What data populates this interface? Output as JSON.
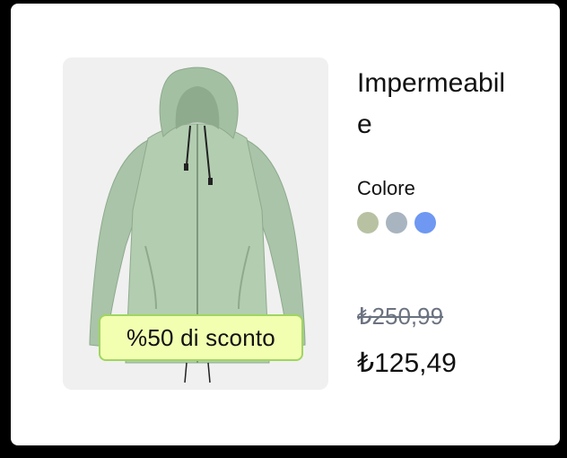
{
  "product": {
    "title": "Impermeabile",
    "image_icon": "green-rain-jacket",
    "discount_badge": "%50 di sconto",
    "color_label": "Colore",
    "colors": [
      "#b8c2a3",
      "#a8b5c0",
      "#6e98f2"
    ],
    "price_original": "₺250,99",
    "price_sale": "₺125,49"
  }
}
